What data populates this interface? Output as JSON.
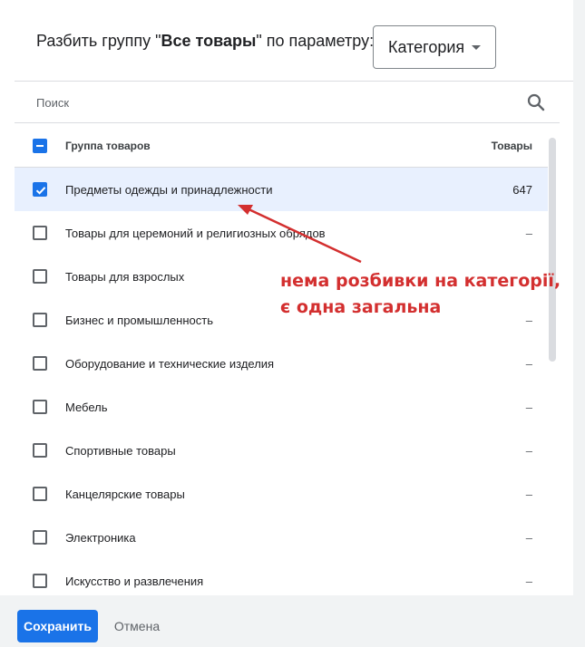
{
  "header": {
    "prefix": "Разбить группу \"",
    "group_name": "Все товары",
    "suffix": "\" по параметру:",
    "dropdown_value": "Категория"
  },
  "search": {
    "placeholder": "Поиск"
  },
  "table": {
    "column_group": "Группа товаров",
    "column_count": "Товары",
    "rows": [
      {
        "label": "Предметы одежды и принадлежности",
        "count": "647",
        "checked": true
      },
      {
        "label": "Товары для церемоний и религиозных обрядов",
        "count": "–",
        "checked": false
      },
      {
        "label": "Товары для взрослых",
        "count": "",
        "checked": false
      },
      {
        "label": "Бизнес и промышленность",
        "count": "–",
        "checked": false
      },
      {
        "label": "Оборудование и технические изделия",
        "count": "–",
        "checked": false
      },
      {
        "label": "Мебель",
        "count": "–",
        "checked": false
      },
      {
        "label": "Спортивные товары",
        "count": "–",
        "checked": false
      },
      {
        "label": "Канцелярские товары",
        "count": "–",
        "checked": false
      },
      {
        "label": "Электроника",
        "count": "–",
        "checked": false
      },
      {
        "label": "Искусство и развлечения",
        "count": "–",
        "checked": false
      }
    ]
  },
  "footer": {
    "save_label": "Сохранить",
    "cancel_label": "Отмена"
  },
  "annotation": {
    "line1": "нема розбивки на категорії,",
    "line2": "є одна загальна",
    "color": "#d32f2f"
  },
  "colors": {
    "accent": "#1a73e8",
    "selected_row": "#e8f0fe",
    "footer_bg": "#f1f3f4"
  },
  "icons": {
    "search": "search-icon",
    "dropdown": "caret-down-icon",
    "checkbox_checked": "checkbox-checked-icon",
    "checkbox_indeterminate": "checkbox-indeterminate-icon"
  }
}
